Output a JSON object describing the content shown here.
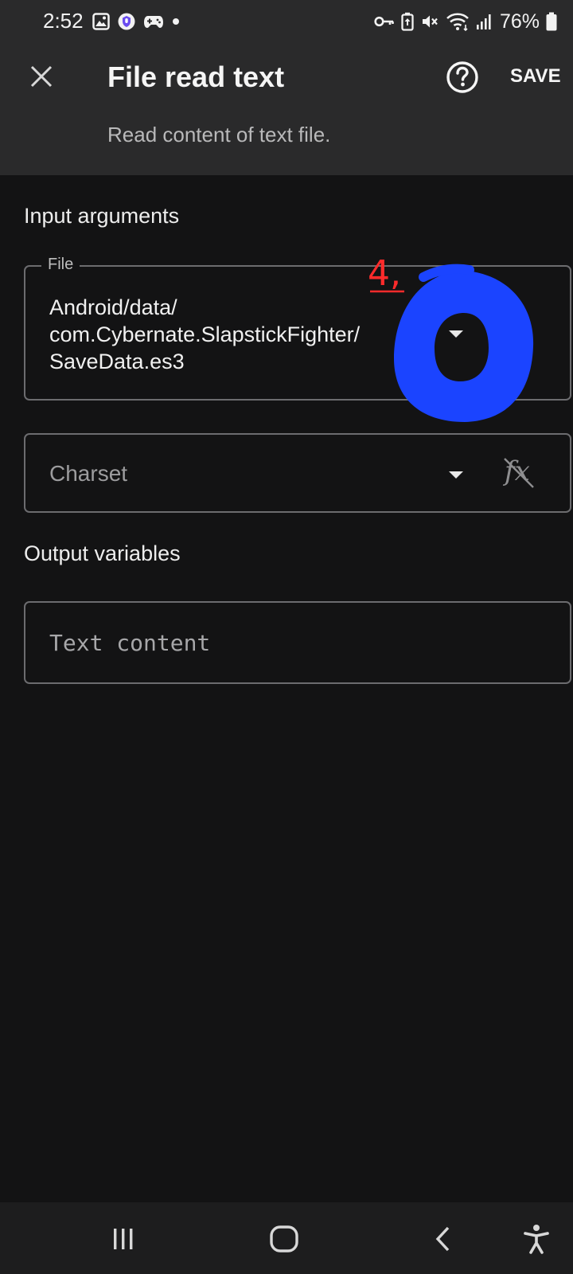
{
  "status_bar": {
    "time": "2:52",
    "battery": "76%",
    "left_icons": [
      "gallery-icon",
      "shield-icon",
      "game-controller-icon",
      "notification-dot-icon"
    ],
    "right_icons": [
      "vpn-key-icon",
      "battery-saver-icon",
      "mute-icon",
      "wifi-icon",
      "signal-icon",
      "battery-icon"
    ]
  },
  "app_bar": {
    "close_icon": "close-icon",
    "title": "File read text",
    "help_icon": "help-icon",
    "save_label": "SAVE",
    "subtitle": "Read content of text file."
  },
  "input_section": {
    "heading": "Input arguments",
    "file_field": {
      "label": "File",
      "value_lines": [
        "Android/data/",
        "com.Cybernate.SlapstickFighter/",
        "SaveData.es3"
      ],
      "dropdown_icon": "dropdown-arrow-icon"
    },
    "charset_field": {
      "placeholder": "Charset",
      "dropdown_icon": "dropdown-arrow-icon",
      "formula_label": "fx"
    }
  },
  "output_section": {
    "heading": "Output variables",
    "text_content_field": {
      "placeholder": "Text content"
    }
  },
  "annotations": {
    "handwritten_note": "4,",
    "handwritten_note_color": "#ff2b2b",
    "scribble_color": "#1b44ff"
  },
  "nav_bar": {
    "buttons": [
      "recents-icon",
      "home-icon",
      "back-icon",
      "accessibility-icon"
    ]
  },
  "colors": {
    "background": "#131314",
    "app_bar": "#2a2a2b",
    "field_border": "#6c6c6f",
    "text_primary": "#f0f0f0",
    "text_secondary": "#b9b9ba"
  }
}
